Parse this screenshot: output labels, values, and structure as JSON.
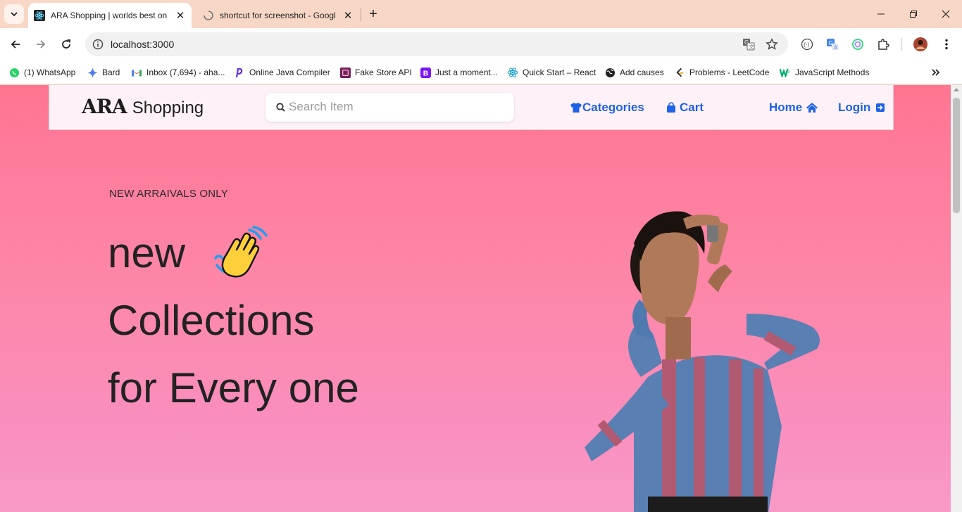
{
  "browser": {
    "tabs": [
      {
        "title": "ARA Shopping | worlds best on",
        "active": true
      },
      {
        "title": "shortcut for screenshot - Googl",
        "active": false
      }
    ],
    "url": "localhost:3000",
    "bookmarks": [
      {
        "label": "(1) WhatsApp",
        "icon": "whatsapp-icon"
      },
      {
        "label": "Bard",
        "icon": "bard-icon"
      },
      {
        "label": "Inbox (7,694) - aha...",
        "icon": "gmail-icon"
      },
      {
        "label": "Online Java Compiler",
        "icon": "programiz-icon"
      },
      {
        "label": "Fake Store API",
        "icon": "fakestore-icon"
      },
      {
        "label": "Just a moment...",
        "icon": "bootstrap-icon"
      },
      {
        "label": "Quick Start – React",
        "icon": "react-icon"
      },
      {
        "label": "Add causes",
        "icon": "globe-icon"
      },
      {
        "label": "Problems - LeetCode",
        "icon": "leetcode-icon"
      },
      {
        "label": "JavaScript Methods",
        "icon": "w3schools-icon"
      }
    ]
  },
  "site": {
    "logo": {
      "brand": "ARA",
      "sub": "Shopping"
    },
    "search": {
      "placeholder": "Search Item"
    },
    "nav": {
      "categories": "Categories",
      "cart": "Cart",
      "home": "Home",
      "login": "Login"
    },
    "accent": "#1d63e8"
  },
  "hero": {
    "eyebrow": "NEW ARRAIVALS ONLY",
    "line1": "new",
    "line2": "Collections",
    "line3": "for Every one"
  }
}
